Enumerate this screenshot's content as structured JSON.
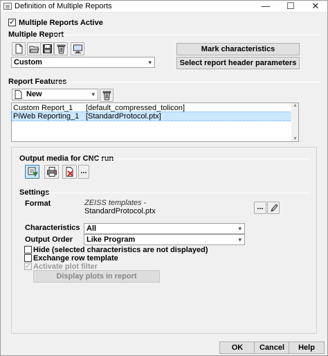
{
  "window": {
    "title": "Definition of Multiple Reports",
    "minimize_glyph": "—",
    "maximize_glyph": "☐",
    "close_glyph": "✕"
  },
  "multiple_reports_active": {
    "label": "Multiple Reports Active",
    "checked": true,
    "check_glyph": "✓"
  },
  "multiple_report": {
    "section_label": "Multiple Report",
    "toolbar_icons": [
      "new-document-icon",
      "open-folder-icon",
      "save-disk-icon",
      "delete-trash-icon",
      "monitor-icon"
    ],
    "combo_value": "Custom",
    "mark_characteristics_label": "Mark characteristics",
    "select_header_label": "Select report header parameters"
  },
  "report_features": {
    "section_label": "Report Features",
    "new_combo_value": "New",
    "rows": [
      {
        "name": "Custom Report_1",
        "value": "[default_compressed_tolicon]",
        "selected": false
      },
      {
        "name": "PiWeb Reporting_1",
        "value": "[StandardProtocol.ptx]",
        "selected": true
      }
    ]
  },
  "output_media": {
    "section_label": "Output media for CNC run",
    "ellipsis_label": "..."
  },
  "settings": {
    "section_label": "Settings",
    "format_label": "Format",
    "format_template_source": "ZEISS templates -",
    "format_template_file": "StandardProtocol.ptx",
    "format_browse_label": "...",
    "characteristics_label": "Characteristics",
    "characteristics_value": "All",
    "output_order_label": "Output Order",
    "output_order_value": "Like Program",
    "hide_label": "Hide (selected characteristics are not displayed)",
    "exchange_row_label": "Exchange row template",
    "activate_plot_label": "Activate plot filter",
    "display_plots_label": "Display plots in report",
    "check_glyph": "✓"
  },
  "footer": {
    "ok_label": "OK",
    "cancel_label": "Cancel",
    "help_label": "Help"
  },
  "combo_arrow_glyph": "▾"
}
